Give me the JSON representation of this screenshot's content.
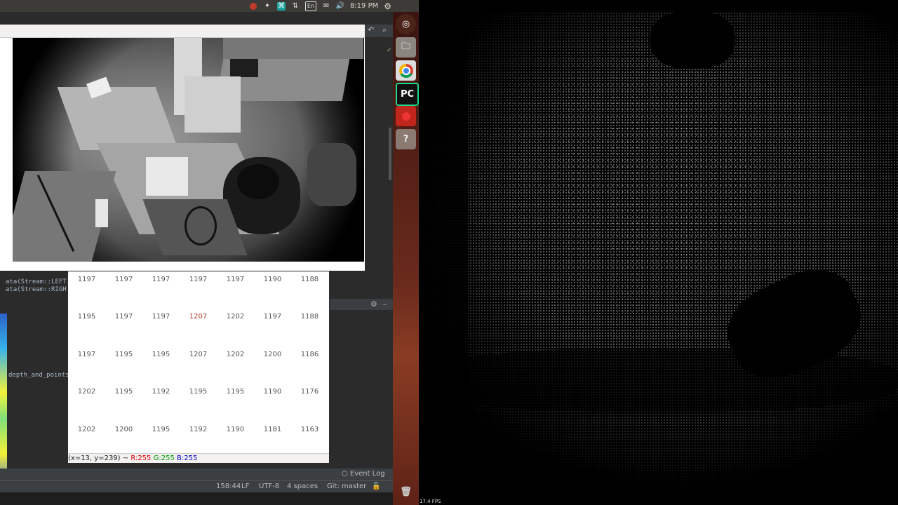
{
  "topbar": {
    "keyboard_layout": "En",
    "clock": "8:19 PM"
  },
  "ide": {
    "code_lines": [
      "ata(Stream::LEFT)",
      "ata(Stream::RIGH"
    ],
    "function_fragment": "depth_and_points",
    "event_log_label": "Event Log",
    "status": {
      "position": "158:44",
      "line_sep": "LF",
      "encoding": "UTF-8",
      "indent": "4 spaces",
      "vcs": "Git: master"
    }
  },
  "matrix": {
    "rows": [
      [
        "1197",
        "1197",
        "1197",
        "1197",
        "1197",
        "1190",
        "1188"
      ],
      [
        "1195",
        "1197",
        "1197",
        "1207",
        "1202",
        "1197",
        "1188"
      ],
      [
        "1197",
        "1195",
        "1195",
        "1207",
        "1202",
        "1200",
        "1186"
      ],
      [
        "1202",
        "1195",
        "1192",
        "1195",
        "1195",
        "1190",
        "1176"
      ],
      [
        "1202",
        "1200",
        "1195",
        "1192",
        "1190",
        "1181",
        "1163"
      ]
    ],
    "highlight_cell": "1207",
    "pixel_info": {
      "coords": "(x=13, y=239) ~",
      "r": "R:255",
      "g": "G:255",
      "b": "B:255"
    }
  },
  "launcher": {
    "items": [
      "ubuntu-dash",
      "files",
      "chrome",
      "pycharm",
      "recorder",
      "unknown-app",
      "trash"
    ],
    "pycharm_label": "PC"
  },
  "cloud": {
    "fps": "17.4 FPS"
  }
}
